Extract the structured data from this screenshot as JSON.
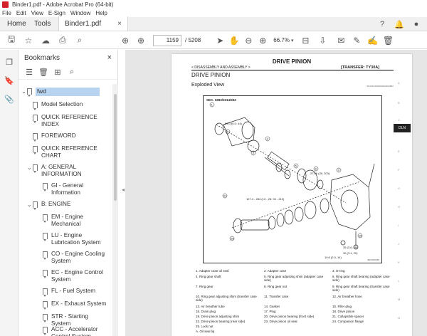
{
  "window": {
    "title": "Binder1.pdf - Adobe Acrobat Pro (64-bit)"
  },
  "menu": [
    "File",
    "Edit",
    "View",
    "E-Sign",
    "Window",
    "Help"
  ],
  "tabs": {
    "home": "Home",
    "tools": "Tools",
    "doc": "Binder1.pdf",
    "close": "×"
  },
  "toolbar": {
    "page_current": "1159",
    "page_total": "/ 5208",
    "zoom": "66.7%"
  },
  "bookmarks": {
    "title": "Bookmarks",
    "close": "×",
    "items": [
      {
        "label": "fwd",
        "level": 0,
        "expanded": true,
        "selected": true
      },
      {
        "label": "Model Selection",
        "level": 1
      },
      {
        "label": "QUICK REFERENCE INDEX",
        "level": 1
      },
      {
        "label": "FOREWORD",
        "level": 1
      },
      {
        "label": "QUICK REFERENCE CHART",
        "level": 1
      },
      {
        "label": "A: GENERAL INFORMATION",
        "level": 1,
        "expanded": true
      },
      {
        "label": "GI - General Information",
        "level": 2
      },
      {
        "label": "B: ENGINE",
        "level": 1,
        "expanded": true
      },
      {
        "label": "EM - Engine Mechanical",
        "level": 2
      },
      {
        "label": "LU - Engine Lubrication System",
        "level": 2
      },
      {
        "label": "CO - Engine Cooling System",
        "level": 2
      },
      {
        "label": "EC - Engine Control System",
        "level": 2
      },
      {
        "label": "FL - Fuel System",
        "level": 2
      },
      {
        "label": "EX - Exhaust System",
        "level": 2
      },
      {
        "label": "STR - Starting System",
        "level": 2
      },
      {
        "label": "ACC - Accelerator Control System",
        "level": 2
      }
    ]
  },
  "document": {
    "title": "DRIVE PINION",
    "breadcrumb": "< DISASSEMBLY AND ASSEMBLY >",
    "section": "[TRANSFER: TY30A]",
    "heading": "DRIVE PINION",
    "subheading": "Exploded View",
    "code": "INFOID:0000000003262884",
    "diagram_sec": "SEC. 3283/3314/332",
    "diagram_code": "JEF0000058",
    "side_tab": "DLN",
    "legend": [
      "1.  Adapter case oil seal",
      "2.  Adapter case",
      "3.  O-ring",
      "4.  Ring gear shaft",
      "5.  Ring gear adjusting shim (adapter case side)",
      "6.  Ring gear shaft bearing (adapter case side)",
      "7.  Ring gear",
      "8.  Ring gear nut",
      "9.  Ring gear shaft bearing (transfer case side)",
      "10. Ring gear adjusting shim (transfer case side)",
      "11. Transfer case",
      "12. Air breather hose",
      "13. Air breather tube",
      "14. Gasket",
      "15. Filler plug",
      "16. Drain plug",
      "17. Plug",
      "18. Drive pinion",
      "19. Drive pinion adjusting shim",
      "20. Drive pinion bearing (front side)",
      "21. Collapsible spacer",
      "22. Drive pinion bearing (rear side)",
      "23. Drive pinion oil seal",
      "24. Companion flange",
      "25. Lock nut",
      "A.  Oil seal lip",
      ""
    ]
  }
}
